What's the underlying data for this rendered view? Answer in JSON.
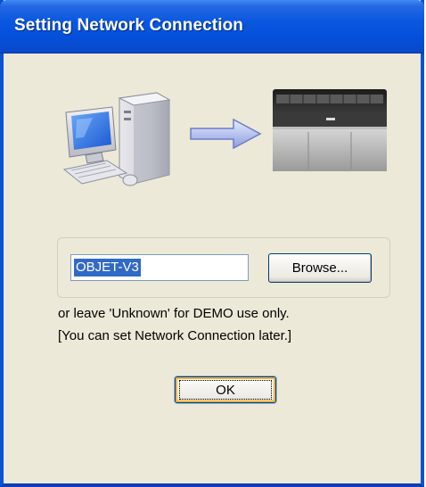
{
  "window": {
    "title": "Setting Network Connection",
    "titlebar_color": "#0a58e0",
    "background_color": "#ece9d8"
  },
  "illustration": {
    "computer_icon": "computer-icon",
    "arrow_icon": "arrow-right-icon",
    "printer_icon": "3d-printer-icon"
  },
  "connection": {
    "printer_name_value": "OBJET-V3",
    "browse_label": "Browse..."
  },
  "notes": {
    "line1": "or leave 'Unknown' for DEMO use only.",
    "line2": "[You can set Network Connection later.]"
  },
  "ok_label": "OK"
}
